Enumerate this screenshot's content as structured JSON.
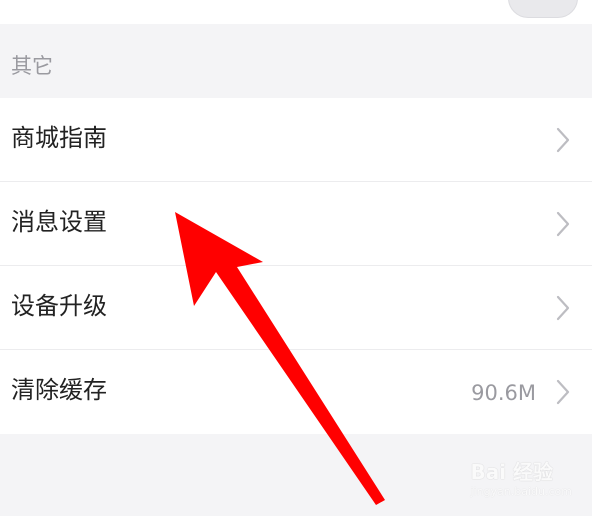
{
  "section": {
    "header": "其它"
  },
  "menu": {
    "items": [
      {
        "label": "商城指南",
        "value": ""
      },
      {
        "label": "消息设置",
        "value": ""
      },
      {
        "label": "设备升级",
        "value": ""
      },
      {
        "label": "清除缓存",
        "value": "90.6M"
      }
    ]
  },
  "watermark": {
    "brand": "Bai  经验",
    "url": "jingyan.baidu.com"
  },
  "colors": {
    "arrow": "#ff0000",
    "background": "#f4f4f6",
    "row": "#ffffff"
  }
}
